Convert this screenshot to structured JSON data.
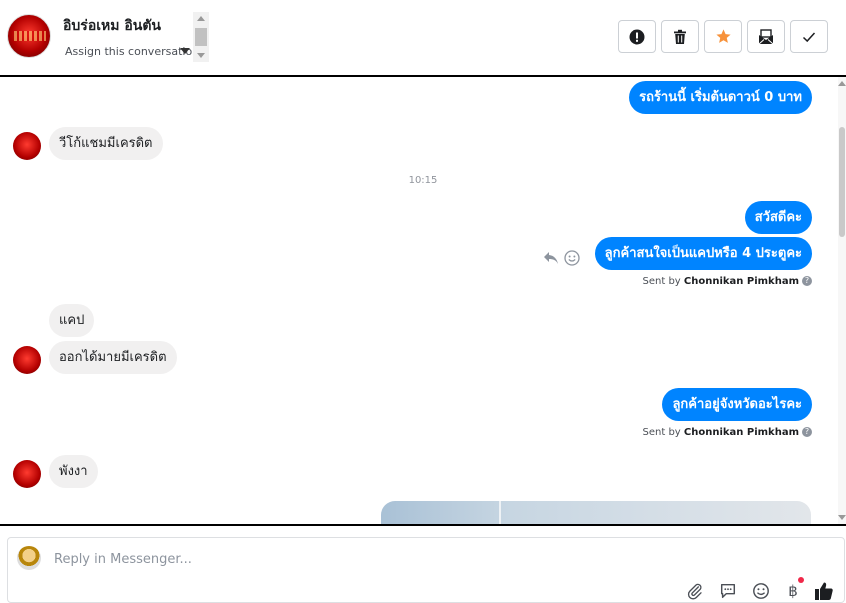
{
  "header": {
    "contact_name": "อิบร่อเหม อินตัน",
    "assign_label": "Assign this conversation",
    "toolbar": [
      {
        "name": "report-spam",
        "icon": "exclamation-circle-icon"
      },
      {
        "name": "delete",
        "icon": "trash-icon"
      },
      {
        "name": "star",
        "icon": "star-icon"
      },
      {
        "name": "mark-unread",
        "icon": "envelope-icon"
      },
      {
        "name": "done",
        "icon": "check-icon"
      }
    ]
  },
  "messages": [
    {
      "dir": "out",
      "text": "รถร้านนี้ เริ่มต้นดาวน์ 0 บาท"
    },
    {
      "dir": "in",
      "text": "วีโก้แชมมีเครดิต"
    },
    {
      "type": "timestamp",
      "text": "10:15"
    },
    {
      "dir": "out",
      "text": "สวัสดีคะ"
    },
    {
      "dir": "out",
      "text": "ลูกค้าสนใจเป็นแคปหรือ 4 ประตูคะ"
    },
    {
      "type": "sent_by",
      "prefix": "Sent by",
      "name": "Chonnikan Pimkham"
    },
    {
      "dir": "in",
      "text": "แคป"
    },
    {
      "dir": "in",
      "text": "ออกได้มายมีเครดิต"
    },
    {
      "dir": "out",
      "text": "ลูกค้าอยู่จังหวัดอะไรคะ"
    },
    {
      "type": "sent_by",
      "prefix": "Sent by",
      "name": "Chonnikan Pimkham"
    },
    {
      "dir": "in",
      "text": "พังงา"
    }
  ],
  "composer": {
    "placeholder": "Reply in Messenger...",
    "icons": [
      "paperclip-icon",
      "saved-replies-icon",
      "emoji-icon",
      "baht-payment-icon",
      "thumbs-up-icon"
    ]
  },
  "colors": {
    "accent": "#0084ff",
    "incoming_bubble": "#f1f0f0",
    "star": "#f7923b",
    "notification_dot": "#f02849"
  }
}
